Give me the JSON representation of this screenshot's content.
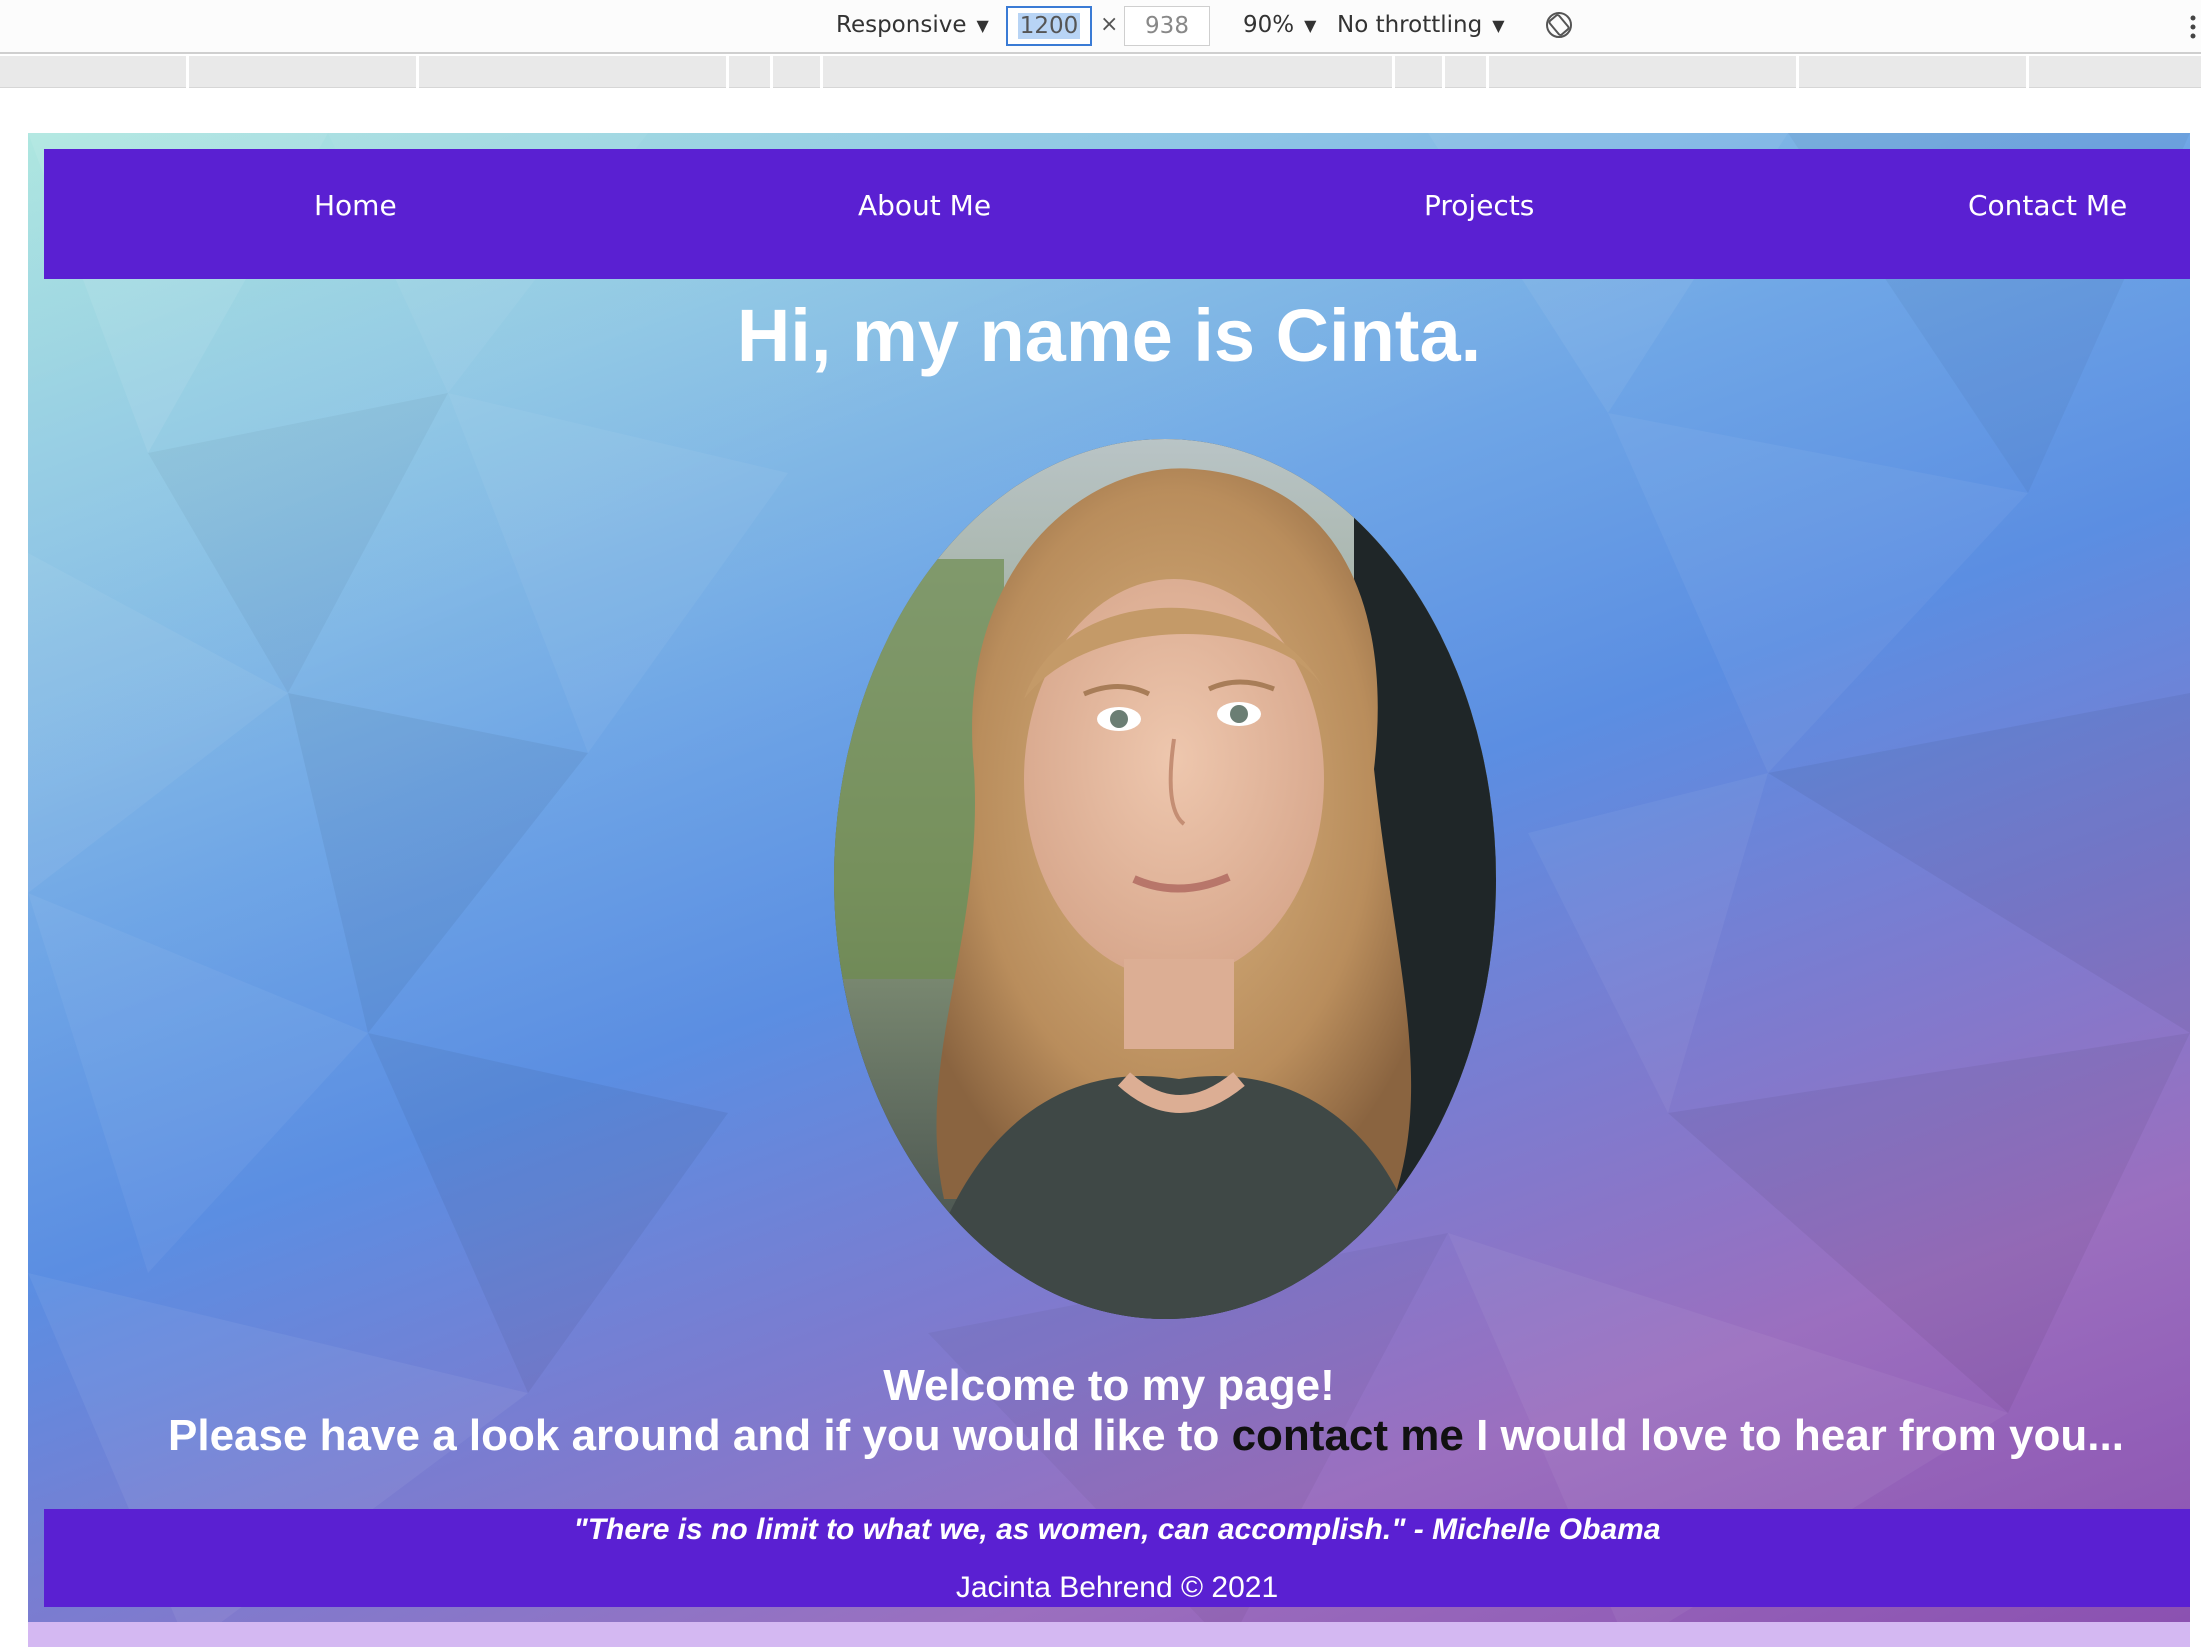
{
  "devtools": {
    "device_mode": "Responsive",
    "width_value": "1200",
    "times": "×",
    "height_placeholder": "938",
    "zoom": "90%",
    "throttling": "No throttling"
  },
  "nav": {
    "items": [
      {
        "label": "Home"
      },
      {
        "label": "About Me"
      },
      {
        "label": "Projects"
      },
      {
        "label": "Contact Me"
      }
    ]
  },
  "hero": {
    "heading": "Hi, my name is Cinta.",
    "welcome_line": "Welcome to my page!",
    "message_before": "Please have a look around and if you would like to ",
    "contact_link": "contact me",
    "message_after": " I would love to hear from you..."
  },
  "footer": {
    "quote": "\"There is no limit to what we, as women, can accomplish.\" - Michelle Obama",
    "copyright": "Jacinta Behrend © 2021"
  },
  "colors": {
    "nav_bg": "#5a20d2",
    "text": "#ffffff",
    "link": "#111111",
    "bottom_strip": "#d4b8f2"
  },
  "icons": [
    "rotate-icon",
    "more-options-icon",
    "dropdown-arrow-icon"
  ]
}
